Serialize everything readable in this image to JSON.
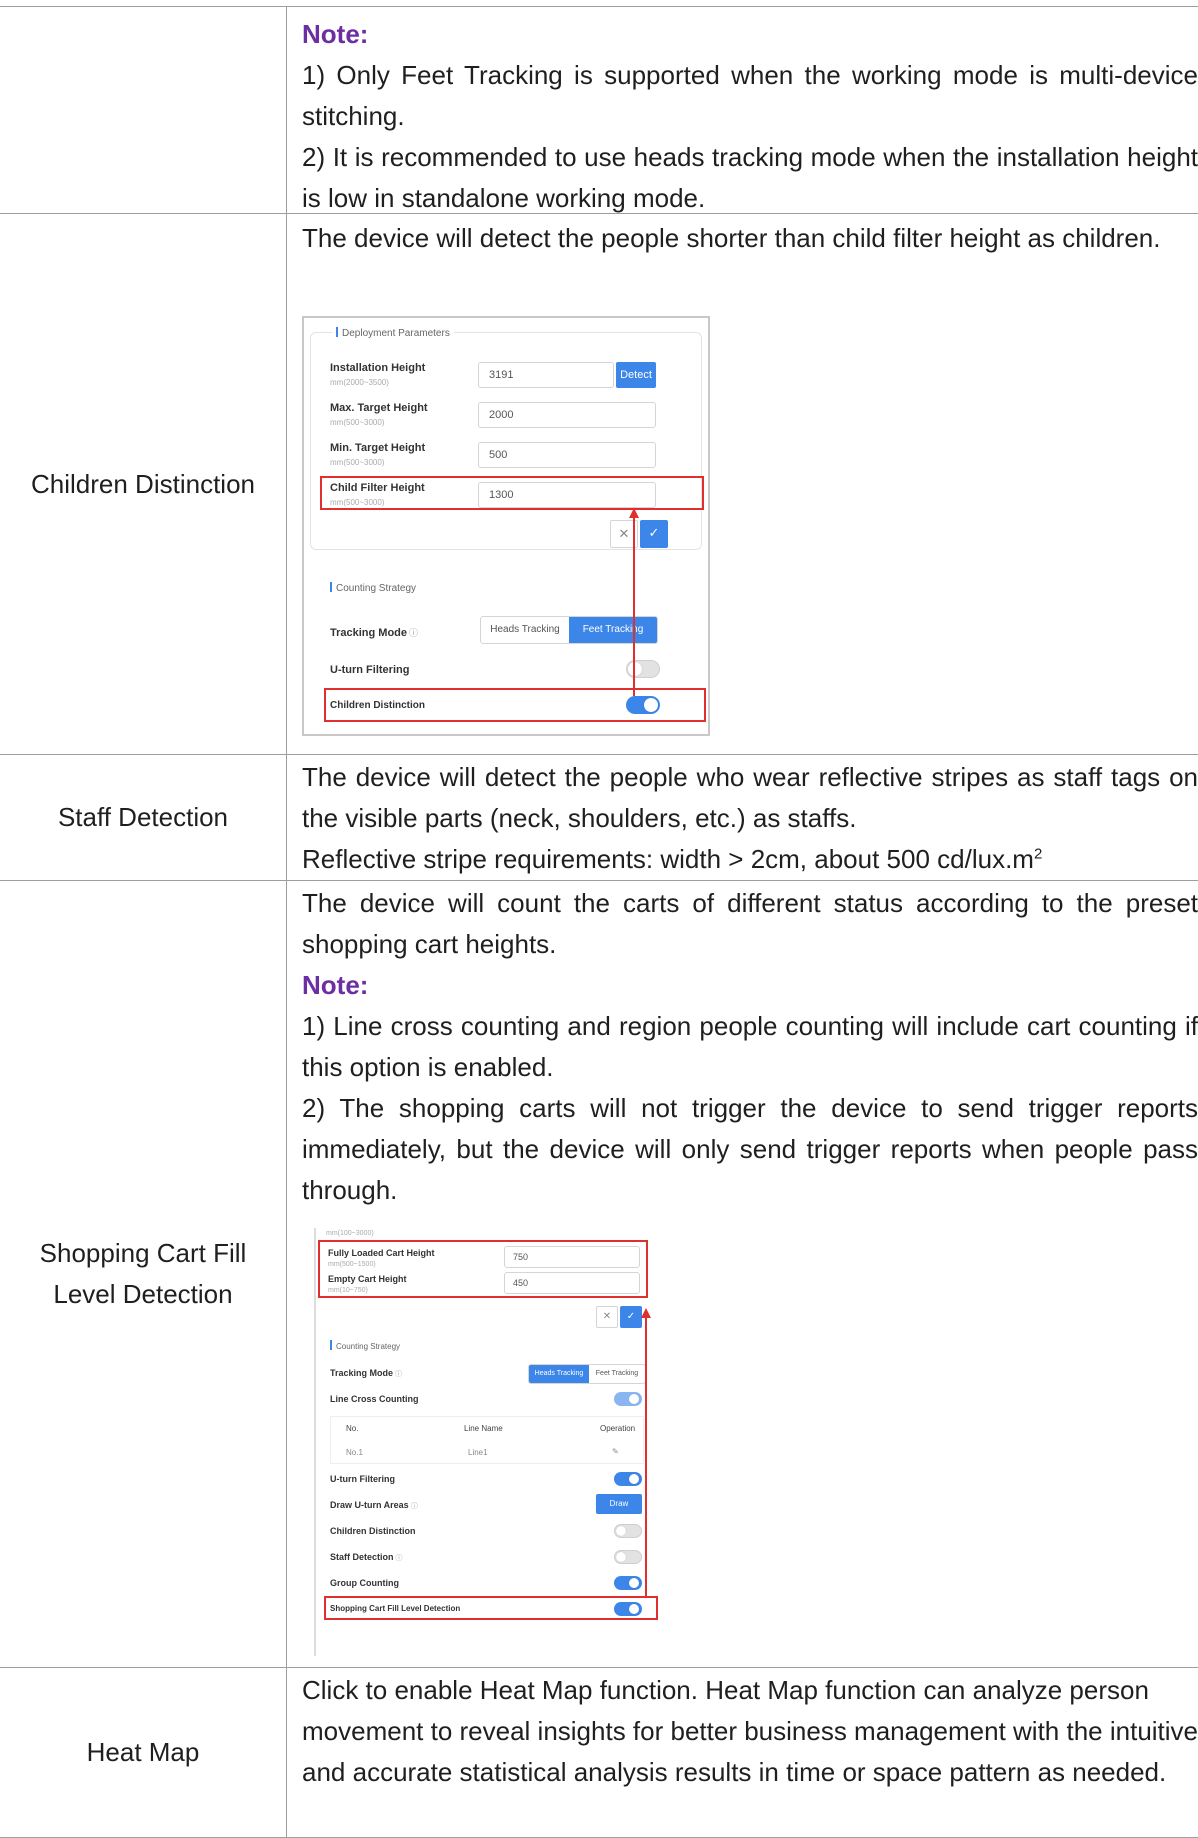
{
  "rows": {
    "r1": {
      "note_label": "Note:",
      "p1": "1) Only Feet Tracking is supported when the working mode is multi-device stitching.",
      "p2": "2) It is recommended to use heads tracking mode when the installation height is low in standalone working mode."
    },
    "r2": {
      "label": "Children Distinction",
      "text": "The device will detect the people shorter than child filter height as children."
    },
    "r3": {
      "label": "Staff Detection",
      "text": "The device will detect the people who wear reflective stripes as staff tags on the visible parts (neck, shoulders, etc.) as staffs.",
      "req": "Reflective stripe requirements: width > 2cm, about 500 cd/lux.m",
      "req_sup": "2"
    },
    "r4": {
      "label_line1": "Shopping Cart Fill",
      "label_line2": "Level Detection",
      "text": "The device will count the carts of different status according to the preset shopping cart heights.",
      "note_label": "Note:",
      "p1": "1) Line cross counting and region people counting will include cart counting if this option is enabled.",
      "p2": "2) The shopping carts will not trigger the device to send trigger reports immediately, but the device will only send trigger reports when people pass through."
    },
    "r5": {
      "label": "Heat Map",
      "text": "Click to enable Heat Map function. Heat Map function can analyze person movement to reveal insights for better business management with the intuitive and accurate statistical analysis results in time or space pattern as needed."
    }
  },
  "shot1": {
    "section_deploy": "Deployment Parameters",
    "install_label": "Installation Height",
    "install_range": "mm(2000~3500)",
    "install_value": "3191",
    "detect_btn": "Detect",
    "max_label": "Max. Target Height",
    "max_range": "mm(500~3000)",
    "max_value": "2000",
    "min_label": "Min. Target Height",
    "min_range": "mm(500~3000)",
    "min_value": "500",
    "child_label": "Child Filter Height",
    "child_range": "mm(500~3000)",
    "child_value": "1300",
    "cancel_icon": "✕",
    "ok_icon": "✓",
    "section_strategy": "Counting Strategy",
    "tracking_label": "Tracking Mode",
    "info_icon": "ⓘ",
    "heads_tracking": "Heads Tracking",
    "feet_tracking": "Feet Tracking",
    "uturn_label": "U-turn Filtering",
    "children_label": "Children Distinction",
    "uturn_on": false,
    "children_on": true
  },
  "shot2": {
    "top_range": "mm(100~3000)",
    "full_label": "Fully Loaded Cart Height",
    "full_range": "mm(500~1500)",
    "full_value": "750",
    "empty_label": "Empty Cart Height",
    "empty_range": "mm(10~750)",
    "empty_value": "450",
    "cancel_icon": "✕",
    "ok_icon": "✓",
    "section_strategy": "Counting Strategy",
    "tracking_label": "Tracking Mode",
    "info_icon": "ⓘ",
    "heads_tracking": "Heads Tracking",
    "feet_tracking": "Feet Tracking",
    "line_cross_label": "Line Cross Counting",
    "col_no": "No.",
    "col_name": "Line Name",
    "col_op": "Operation",
    "row_no": "No.1",
    "row_name": "Line1",
    "edit_icon": "✎",
    "uturn_label": "U-turn Filtering",
    "draw_areas_label": "Draw U-turn Areas",
    "draw_btn": "Draw",
    "children_label": "Children Distinction",
    "staff_label": "Staff Detection",
    "group_label": "Group Counting",
    "cart_label": "Shopping Cart Fill Level Detection",
    "line_cross_on": true,
    "uturn_on": true,
    "children_on": false,
    "staff_on": false,
    "group_on": true,
    "cart_on": true
  },
  "colors": {
    "note": "#6b2fa3",
    "accent": "#3b86e8",
    "highlight": "#e0302e",
    "border": "#9e9e9e"
  }
}
